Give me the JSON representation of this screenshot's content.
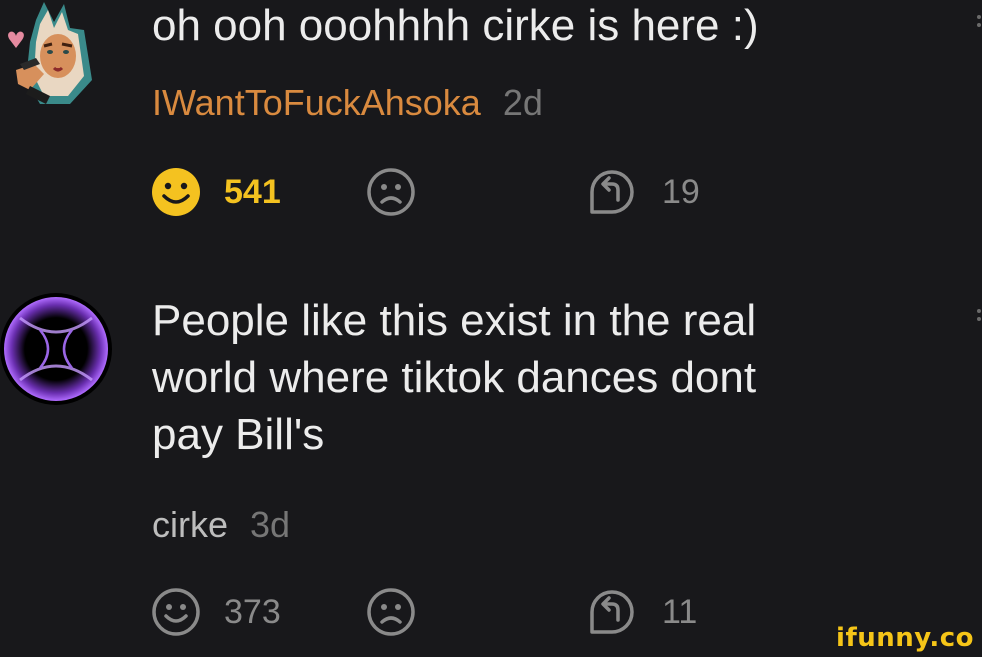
{
  "comments": [
    {
      "text": "oh ooh ooohhhh cirke is here :)",
      "username": "IWantToFuckAhsoka",
      "time": "2d",
      "smile_count": "541",
      "reply_count": "19",
      "smile_active": true,
      "avatar_icon": "cartoon-avatar-icon"
    },
    {
      "text_lines": [
        "People like this exist in the real",
        "world where tiktok dances dont",
        "pay Bill's"
      ],
      "username": "cirke",
      "time": "3d",
      "smile_count": "373",
      "reply_count": "11",
      "smile_active": false,
      "avatar_icon": "purple-ring-avatar-icon"
    }
  ],
  "colors": {
    "background": "#18181b",
    "username_highlight": "#d98a3f",
    "active_smile": "#f4c220",
    "muted": "#8a8a8a"
  },
  "watermark": "ifunny.co"
}
